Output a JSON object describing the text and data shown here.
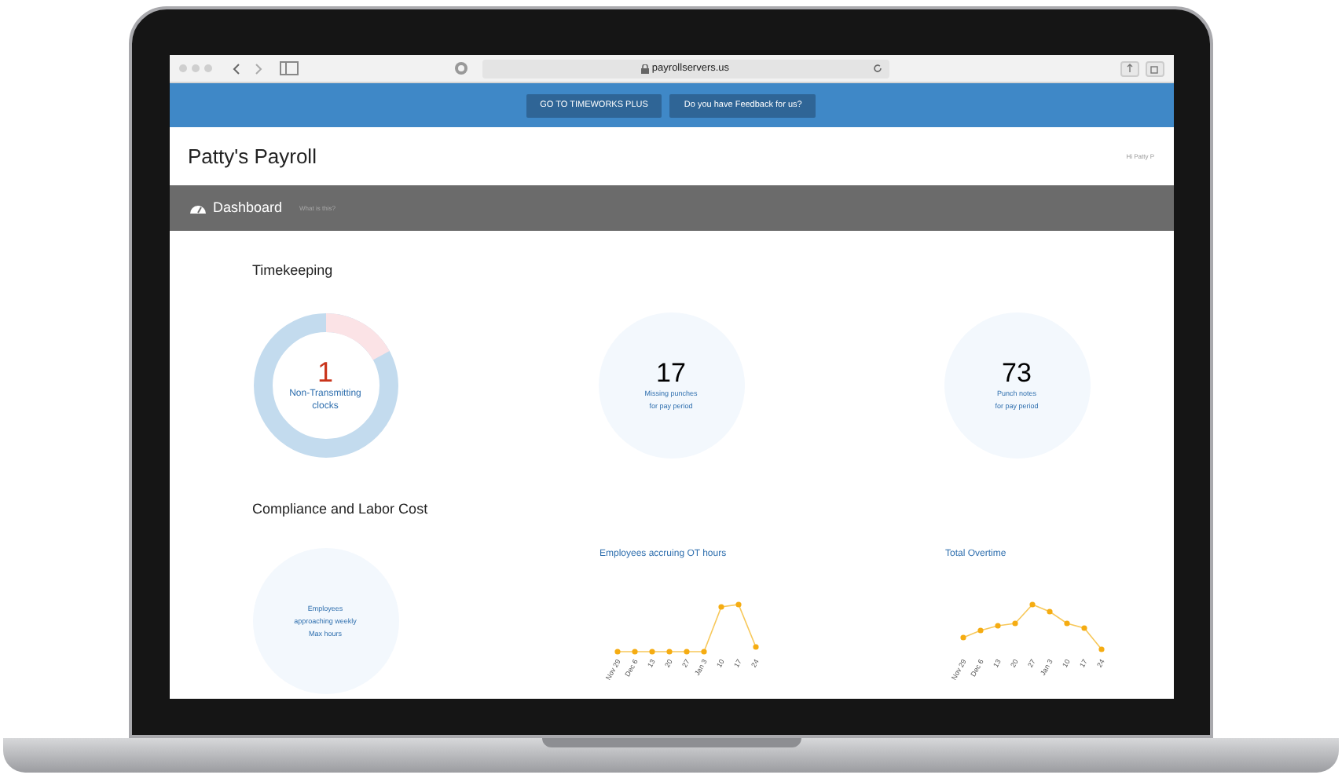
{
  "browser": {
    "url": "payrollservers.us"
  },
  "top_bar": {
    "buttons": [
      "GO TO TIMEWORKS PLUS",
      "Do you have Feedback for us?"
    ]
  },
  "header": {
    "title": "Patty's Payroll",
    "greeting": "Hi Patty P"
  },
  "page_bar": {
    "title": "Dashboard",
    "help_link": "What is this?"
  },
  "timekeeping": {
    "title": "Timekeeping",
    "cards": [
      {
        "kind": "donut",
        "value": "1",
        "label_lines": [
          "Non-Transmitting",
          "clocks"
        ],
        "level": 0.17
      },
      {
        "kind": "circle",
        "value": "17",
        "label_lines": [
          "Missing punches",
          "for pay period"
        ]
      },
      {
        "kind": "circle",
        "value": "73",
        "label_lines": [
          "Punch notes",
          "for pay period"
        ]
      }
    ]
  },
  "compliance": {
    "title": "Compliance and Labor Cost",
    "items": [
      {
        "kind": "circle",
        "label_lines": [
          "Employees",
          "approaching weekly",
          "Max hours"
        ]
      },
      {
        "kind": "sparkline",
        "title": "Employees accruing OT hours",
        "x_labels": [
          "Nov 29",
          "Dec 6",
          "13",
          "20",
          "27",
          "Jan 3",
          "10",
          "17",
          "24"
        ]
      },
      {
        "kind": "sparkline",
        "title": "Total Overtime",
        "x_labels": [
          "Nov 29",
          "Dec 6",
          "13",
          "20",
          "27",
          "Jan 3",
          "10",
          "17",
          "24"
        ]
      }
    ]
  }
}
